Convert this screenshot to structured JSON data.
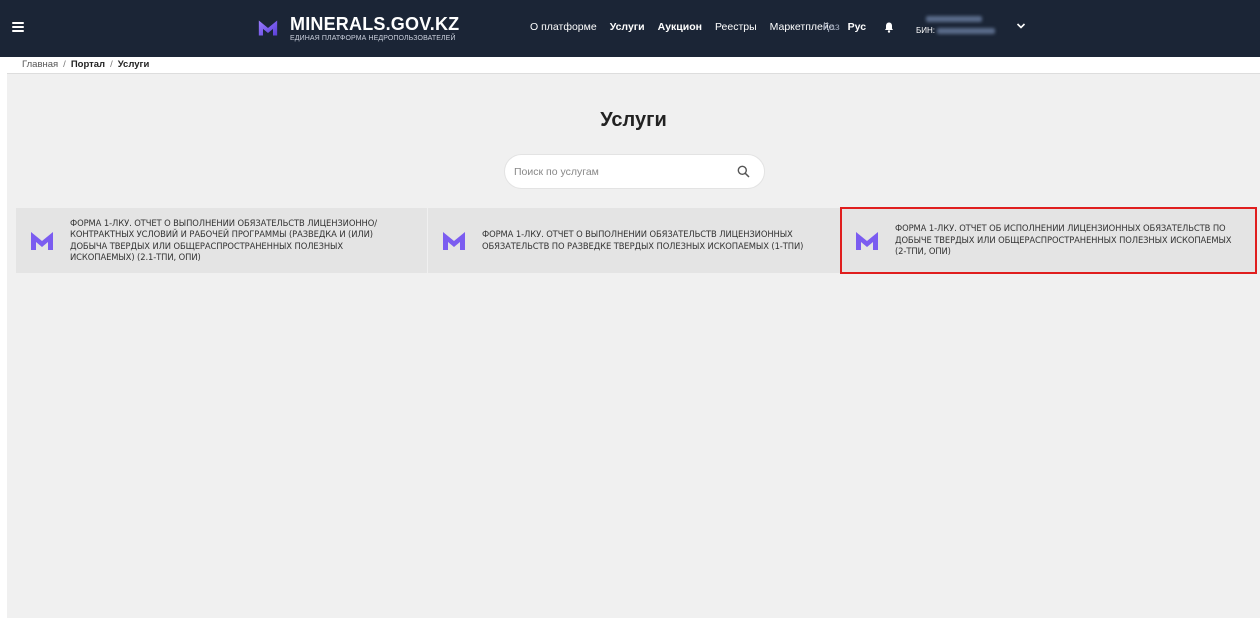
{
  "header": {
    "logo_title": "MINERALS.GOV.KZ",
    "logo_subtitle": "ЕДИНАЯ ПЛАТФОРМА НЕДРОПОЛЬЗОВАТЕЛЕЙ",
    "nav": [
      {
        "label": "О платформе"
      },
      {
        "label": "Услуги"
      },
      {
        "label": "Аукцион"
      },
      {
        "label": "Реестры"
      },
      {
        "label": "Маркетплейс"
      }
    ],
    "lang_kz": "Қаз",
    "lang_ru": "Рус",
    "user_bin_label": "БИН:"
  },
  "breadcrumb": {
    "home": "Главная",
    "portal": "Портал",
    "current": "Услуги",
    "separator": "/"
  },
  "main": {
    "title": "Услуги",
    "search_placeholder": "Поиск по услугам",
    "cards": [
      {
        "text": "ФОРМА 1-ЛКУ. ОТЧЕТ О ВЫПОЛНЕНИИ ОБЯЗАТЕЛЬСТВ ЛИЦЕНЗИОННО/ КОНТРАКТНЫХ УСЛОВИЙ И РАБОЧЕЙ ПРОГРАММЫ (РАЗВЕДКА И (ИЛИ) ДОБЫЧА ТВЕРДЫХ ИЛИ ОБЩЕРАСПРОСТРАНЕННЫХ ПОЛЕЗНЫХ ИСКОПАЕМЫХ) (2.1-ТПИ, ОПИ)"
      },
      {
        "text": "ФОРМА 1-ЛКУ. ОТЧЕТ О ВЫПОЛНЕНИИ ОБЯЗАТЕЛЬСТВ ЛИЦЕНЗИОННЫХ ОБЯЗАТЕЛЬСТВ ПО РАЗВЕДКЕ ТВЕРДЫХ ПОЛЕЗНЫХ ИСКОПАЕМЫХ (1-ТПИ)"
      },
      {
        "text": "ФОРМА 1-ЛКУ. ОТЧЕТ ОБ ИСПОЛНЕНИИ ЛИЦЕНЗИОННЫХ ОБЯЗАТЕЛЬСТВ ПО ДОБЫЧЕ ТВЕРДЫХ ИЛИ ОБЩЕРАСПРОСТРАНЕННЫХ ПОЛЕЗНЫХ ИСКОПАЕМЫХ (2-ТПИ, ОПИ)"
      }
    ]
  },
  "colors": {
    "header_bg": "#1b2536",
    "accent": "#7b5cf0",
    "highlight": "#e01e1e"
  },
  "icons": {
    "menu": "hamburger-icon",
    "logo": "m-logo-icon",
    "bell": "bell-icon",
    "chevron": "chevron-down-icon",
    "search": "search-icon"
  }
}
